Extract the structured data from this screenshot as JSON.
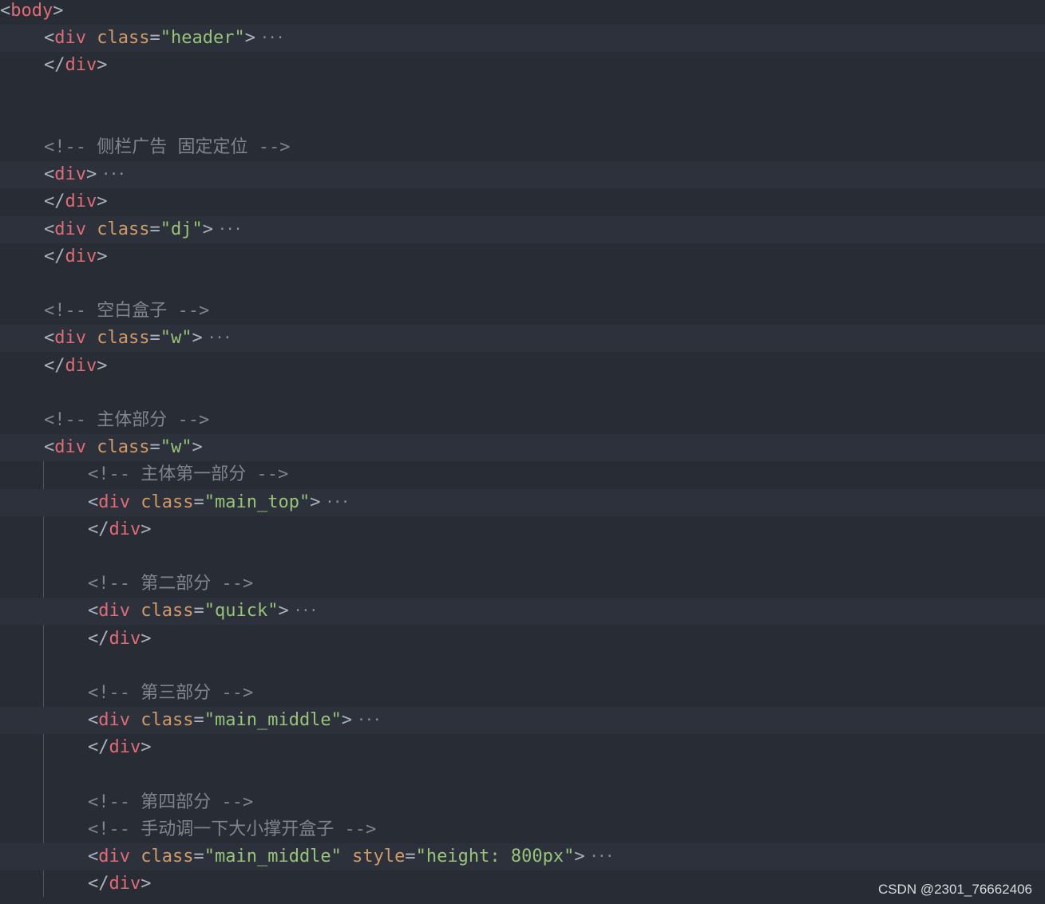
{
  "code_lines": [
    {
      "indent": 0,
      "type": "open",
      "tag": "body",
      "attrs": [],
      "folded": false,
      "highlighted": false
    },
    {
      "indent": 1,
      "type": "open",
      "tag": "div",
      "attrs": [
        {
          "name": "class",
          "value": "\"header\""
        }
      ],
      "folded": true,
      "highlighted": true
    },
    {
      "indent": 1,
      "type": "close",
      "tag": "div",
      "highlighted": false
    },
    {
      "indent": 0,
      "type": "blank",
      "highlighted": false
    },
    {
      "indent": 0,
      "type": "blank",
      "highlighted": false
    },
    {
      "indent": 1,
      "type": "comment",
      "text": "<!-- 侧栏广告 固定定位 -->",
      "highlighted": false
    },
    {
      "indent": 1,
      "type": "open",
      "tag": "div",
      "attrs": [],
      "folded": true,
      "highlighted": true
    },
    {
      "indent": 1,
      "type": "close",
      "tag": "div",
      "highlighted": false
    },
    {
      "indent": 1,
      "type": "open",
      "tag": "div",
      "attrs": [
        {
          "name": "class",
          "value": "\"dj\""
        }
      ],
      "folded": true,
      "highlighted": true
    },
    {
      "indent": 1,
      "type": "close",
      "tag": "div",
      "highlighted": false
    },
    {
      "indent": 0,
      "type": "blank",
      "highlighted": false
    },
    {
      "indent": 1,
      "type": "comment",
      "text": "<!-- 空白盒子 -->",
      "highlighted": false
    },
    {
      "indent": 1,
      "type": "open",
      "tag": "div",
      "attrs": [
        {
          "name": "class",
          "value": "\"w\""
        }
      ],
      "folded": true,
      "highlighted": true
    },
    {
      "indent": 1,
      "type": "close",
      "tag": "div",
      "highlighted": false
    },
    {
      "indent": 0,
      "type": "blank",
      "highlighted": false
    },
    {
      "indent": 1,
      "type": "comment",
      "text": "<!-- 主体部分 -->",
      "highlighted": false
    },
    {
      "indent": 1,
      "type": "open",
      "tag": "div",
      "attrs": [
        {
          "name": "class",
          "value": "\"w\""
        }
      ],
      "folded": false,
      "highlighted": true
    },
    {
      "indent": 2,
      "type": "comment",
      "text": "<!-- 主体第一部分 -->",
      "highlighted": false
    },
    {
      "indent": 2,
      "type": "open",
      "tag": "div",
      "attrs": [
        {
          "name": "class",
          "value": "\"main_top\""
        }
      ],
      "folded": true,
      "highlighted": true
    },
    {
      "indent": 2,
      "type": "close",
      "tag": "div",
      "highlighted": false
    },
    {
      "indent": 0,
      "type": "blank",
      "highlighted": false
    },
    {
      "indent": 2,
      "type": "comment",
      "text": "<!-- 第二部分 -->",
      "highlighted": false
    },
    {
      "indent": 2,
      "type": "open",
      "tag": "div",
      "attrs": [
        {
          "name": "class",
          "value": "\"quick\""
        }
      ],
      "folded": true,
      "highlighted": true
    },
    {
      "indent": 2,
      "type": "close",
      "tag": "div",
      "highlighted": false
    },
    {
      "indent": 0,
      "type": "blank",
      "highlighted": false
    },
    {
      "indent": 2,
      "type": "comment",
      "text": "<!-- 第三部分 -->",
      "highlighted": false
    },
    {
      "indent": 2,
      "type": "open",
      "tag": "div",
      "attrs": [
        {
          "name": "class",
          "value": "\"main_middle\""
        }
      ],
      "folded": true,
      "highlighted": true
    },
    {
      "indent": 2,
      "type": "close",
      "tag": "div",
      "highlighted": false
    },
    {
      "indent": 0,
      "type": "blank",
      "highlighted": false
    },
    {
      "indent": 2,
      "type": "comment",
      "text": "<!-- 第四部分 -->",
      "highlighted": false
    },
    {
      "indent": 2,
      "type": "comment",
      "text": "<!-- 手动调一下大小撑开盒子 -->",
      "highlighted": false
    },
    {
      "indent": 2,
      "type": "open",
      "tag": "div",
      "attrs": [
        {
          "name": "class",
          "value": "\"main_middle\""
        },
        {
          "name": "style",
          "value": "\"height: 800px\""
        }
      ],
      "folded": true,
      "highlighted": true
    },
    {
      "indent": 2,
      "type": "close",
      "tag": "div",
      "highlighted": false
    }
  ],
  "fold_marker": "···",
  "watermark": "CSDN @2301_76662406",
  "colors": {
    "background": "#282c34",
    "highlight_line": "#2c313c",
    "tag": "#e06c75",
    "attribute": "#d19a66",
    "string": "#98c379",
    "comment": "#7f848e",
    "punctuation": "#abb2bf"
  }
}
